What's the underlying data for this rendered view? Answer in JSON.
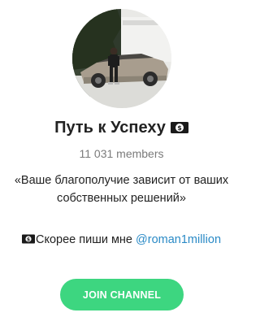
{
  "channel": {
    "title": "Путь к Успеху",
    "members": "11 031 members",
    "description": "«Ваше благополучие зависит от ваших собственных решений»",
    "contact_text": "Скорее пиши мне ",
    "contact_link": "@roman1million",
    "join_label": "JOIN CHANNEL"
  },
  "icons": {
    "title_icon": "money-with-dollar-icon",
    "contact_icon": "money-with-dollar-icon"
  },
  "colors": {
    "join_button": "#3dd680",
    "link": "#2a8ac6",
    "members_text": "#7b7b7b",
    "title_text": "#222222"
  }
}
